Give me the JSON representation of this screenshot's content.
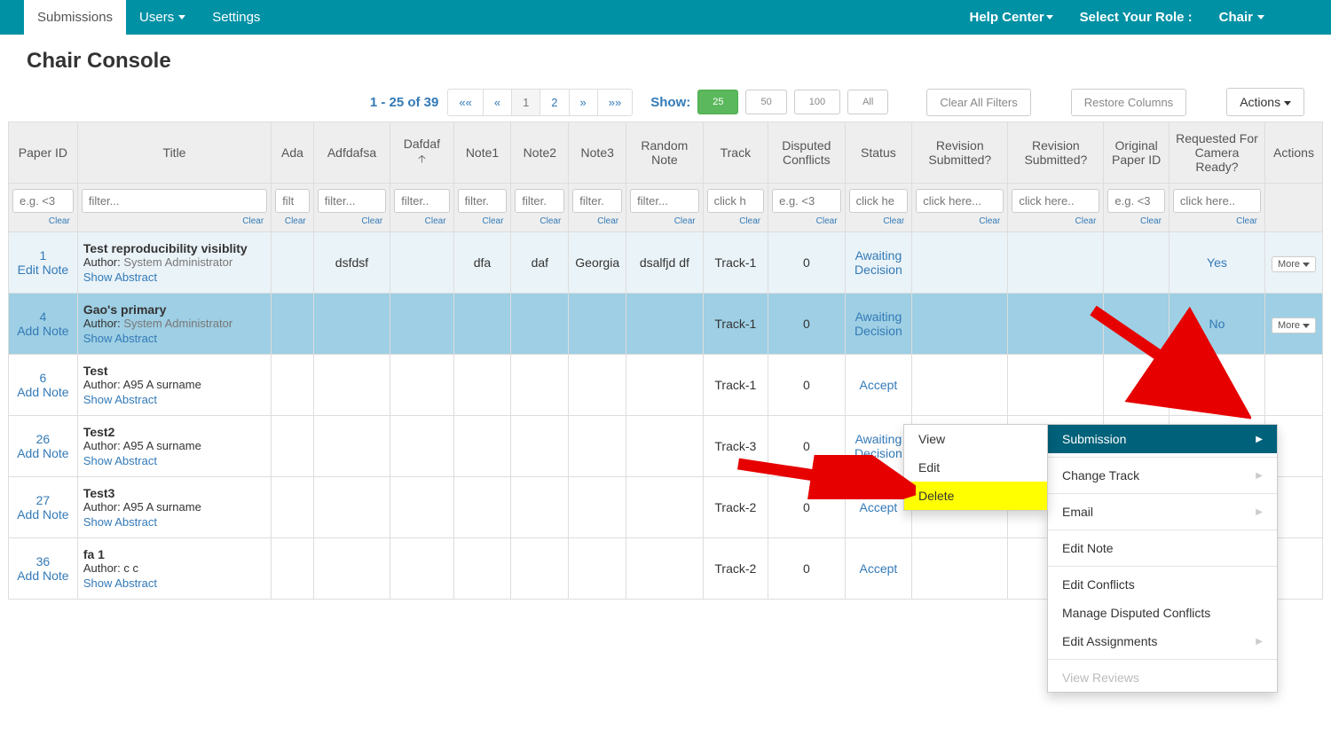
{
  "nav": {
    "submissions": "Submissions",
    "users": "Users",
    "settings": "Settings",
    "help": "Help Center",
    "role_label": "Select Your Role :",
    "role_value": "Chair"
  },
  "page_title": "Chair Console",
  "toolbar": {
    "range": "1 - 25 of 39",
    "pager": {
      "first": "««",
      "prev": "«",
      "p1": "1",
      "p2": "2",
      "next": "»",
      "last": "»»"
    },
    "show_label": "Show:",
    "show": {
      "s25": "25",
      "s50": "50",
      "s100": "100",
      "all": "All"
    },
    "clear_filters": "Clear All Filters",
    "restore_cols": "Restore Columns",
    "actions": "Actions"
  },
  "headers": {
    "paper_id": "Paper ID",
    "title": "Title",
    "ada": "Ada",
    "adf": "Adfdafsa",
    "daf": "Dafdaf",
    "note1": "Note1",
    "note2": "Note2",
    "note3": "Note3",
    "random": "Random Note",
    "track": "Track",
    "disputed": "Disputed Conflicts",
    "status": "Status",
    "rev1": "Revision Submitted?",
    "rev2": "Revision Submitted?",
    "orig": "Original Paper ID",
    "camera": "Requested For Camera Ready?",
    "actions": "Actions"
  },
  "filters": {
    "clear": "Clear",
    "ph": {
      "id": "e.g. <3",
      "title": "filter...",
      "ada": "filt",
      "adf": "filter...",
      "daf": "filter..",
      "note": "filter.",
      "random": "filter...",
      "track": "click h",
      "disputed": "e.g. <3",
      "status": "click he",
      "rev": "click here...",
      "rev2": "click here..",
      "orig": "e.g. <3",
      "camera": "click here.."
    }
  },
  "labels": {
    "author_prefix": "Author: ",
    "show_abstract": "Show Abstract",
    "edit_note": "Edit Note",
    "add_note": "Add Note",
    "more": "More"
  },
  "rows": [
    {
      "id": "1",
      "note_action": "Edit Note",
      "title": "Test reproducibility visiblity",
      "author": "System Administrator",
      "author_sys": true,
      "adf": "dsfdsf",
      "note1": "dfa",
      "note2": "daf",
      "note3": "Georgia",
      "random": "dsalfjd df",
      "track": "Track-1",
      "disputed": "0",
      "status": "Awaiting Decision",
      "camera": "Yes",
      "highlight": true,
      "showmore": true
    },
    {
      "id": "4",
      "note_action": "Add Note",
      "title": "Gao's primary",
      "author": "System Administrator",
      "author_sys": true,
      "track": "Track-1",
      "disputed": "0",
      "status": "Awaiting Decision",
      "camera": "No",
      "selected": true,
      "showmore": true
    },
    {
      "id": "6",
      "note_action": "Add Note",
      "title": "Test",
      "author": "A95 A surname",
      "track": "Track-1",
      "disputed": "0",
      "status": "Accept"
    },
    {
      "id": "26",
      "note_action": "Add Note",
      "title": "Test2",
      "author": "A95 A surname",
      "track": "Track-3",
      "disputed": "0",
      "status": "Awaiting Decision"
    },
    {
      "id": "27",
      "note_action": "Add Note",
      "title": "Test3",
      "author": "A95 A surname",
      "track": "Track-2",
      "disputed": "0",
      "status": "Accept"
    },
    {
      "id": "36",
      "note_action": "Add Note",
      "title": "fa 1",
      "author": "c c",
      "track": "Track-2",
      "disputed": "0",
      "status": "Accept"
    }
  ],
  "menu": {
    "submission": "Submission",
    "change_track": "Change Track",
    "email": "Email",
    "edit_note": "Edit Note",
    "edit_conflicts": "Edit Conflicts",
    "manage_disputed": "Manage Disputed Conflicts",
    "edit_assignments": "Edit Assignments",
    "view_reviews": "View Reviews"
  },
  "submenu": {
    "view": "View",
    "edit": "Edit",
    "delete": "Delete"
  }
}
